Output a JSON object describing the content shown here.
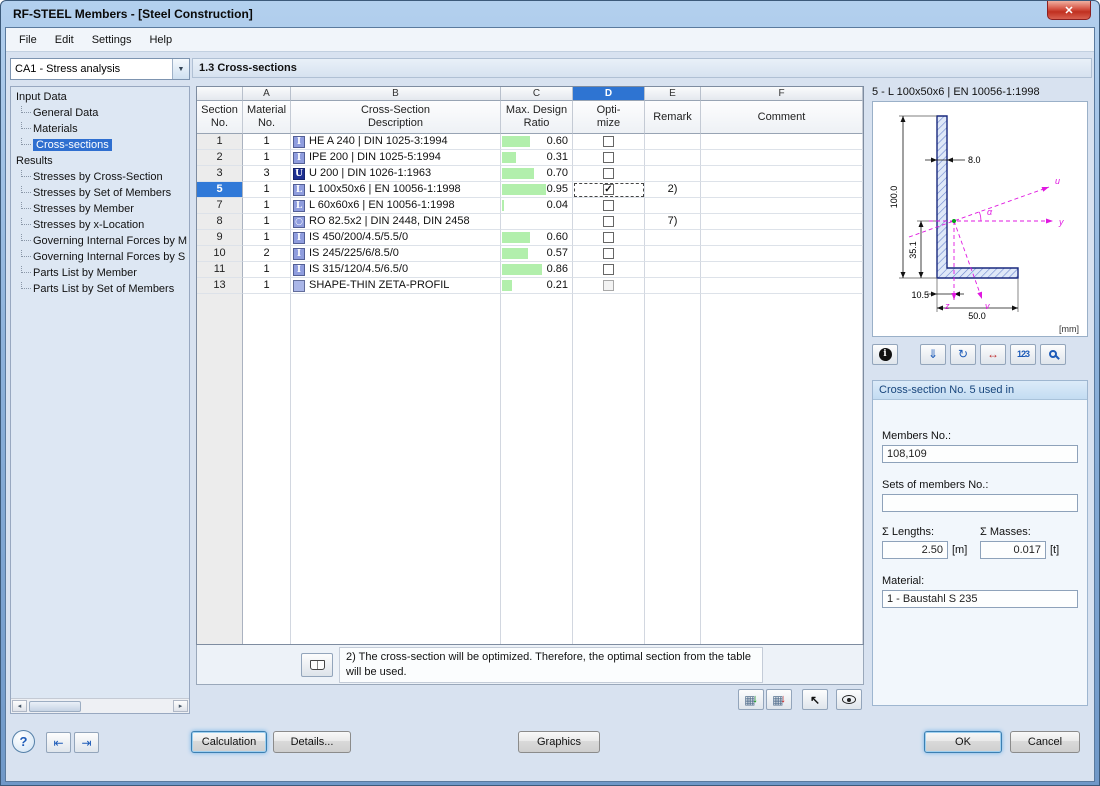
{
  "window": {
    "title": "RF-STEEL Members - [Steel Construction]"
  },
  "icons": {
    "close": "✕",
    "combo_arrow": "▼",
    "check": "✓",
    "scroll_left": "◂",
    "scroll_right": "▸",
    "info": "i",
    "save": "⇓",
    "rotate": "↻",
    "dims": "↔",
    "values": "123",
    "help": "?",
    "panel_left": "⇤",
    "panel_right": "⇥",
    "grid": "▦",
    "down_arrow": "↓",
    "pick": "↖"
  },
  "menu": {
    "items": [
      "File",
      "Edit",
      "Settings",
      "Help"
    ]
  },
  "case_selector": {
    "value": "CA1 - Stress analysis"
  },
  "nav": {
    "groups": [
      {
        "label": "Input Data",
        "items": [
          "General Data",
          "Materials",
          "Cross-sections"
        ]
      },
      {
        "label": "Results",
        "items": [
          "Stresses by Cross-Section",
          "Stresses by Set of Members",
          "Stresses by Member",
          "Stresses by x-Location",
          "Governing Internal Forces by M",
          "Governing Internal Forces by S",
          "Parts List by Member",
          "Parts List by Set of Members"
        ]
      }
    ],
    "selected": "Cross-sections"
  },
  "page": {
    "title": "1.3 Cross-sections"
  },
  "table": {
    "column_letters": [
      "",
      "A",
      "B",
      "C",
      "D",
      "E",
      "F"
    ],
    "current_letter": "D",
    "headers": [
      "Section\nNo.",
      "Material\nNo.",
      "Cross-Section\nDescription",
      "Max. Design\nRatio",
      "Opti-\nmize",
      "Remark",
      "Comment"
    ],
    "rows": [
      {
        "no": "1",
        "material": "1",
        "glyph": "I",
        "chip": "#8f9dde",
        "desc": "HE A 240 | DIN 1025-3:1994",
        "ratio": "0.60",
        "optimize": false,
        "remark": "",
        "comment": "",
        "selected": false,
        "disabled": false
      },
      {
        "no": "2",
        "material": "1",
        "glyph": "I",
        "chip": "#8f9dde",
        "desc": "IPE 200 | DIN 1025-5:1994",
        "ratio": "0.31",
        "optimize": false,
        "remark": "",
        "comment": "",
        "selected": false,
        "disabled": false
      },
      {
        "no": "3",
        "material": "3",
        "glyph": "U",
        "chip": "#1c2f92",
        "desc": "U 200 | DIN 1026-1:1963",
        "ratio": "0.70",
        "optimize": false,
        "remark": "",
        "comment": "",
        "selected": false,
        "disabled": false
      },
      {
        "no": "5",
        "material": "1",
        "glyph": "L",
        "chip": "#8f9dde",
        "desc": "L 100x50x6 | EN 10056-1:1998",
        "ratio": "0.95",
        "optimize": true,
        "remark": "2)",
        "comment": "",
        "selected": true,
        "disabled": false
      },
      {
        "no": "7",
        "material": "1",
        "glyph": "L",
        "chip": "#8f9dde",
        "desc": "L 60x60x6 | EN 10056-1:1998",
        "ratio": "0.04",
        "optimize": false,
        "remark": "",
        "comment": "",
        "selected": false,
        "disabled": false
      },
      {
        "no": "8",
        "material": "1",
        "glyph": "○",
        "chip": "#8f9dde",
        "desc": "RO 82.5x2 | DIN 2448, DIN 2458",
        "ratio": "",
        "optimize": false,
        "remark": "7)",
        "comment": "",
        "selected": false,
        "disabled": false
      },
      {
        "no": "9",
        "material": "1",
        "glyph": "I",
        "chip": "#8f9dde",
        "desc": "IS 450/200/4.5/5.5/0",
        "ratio": "0.60",
        "optimize": false,
        "remark": "",
        "comment": "",
        "selected": false,
        "disabled": false
      },
      {
        "no": "10",
        "material": "2",
        "glyph": "I",
        "chip": "#8f9dde",
        "desc": "IS 245/225/6/8.5/0",
        "ratio": "0.57",
        "optimize": false,
        "remark": "",
        "comment": "",
        "selected": false,
        "disabled": false
      },
      {
        "no": "11",
        "material": "1",
        "glyph": "I",
        "chip": "#8f9dde",
        "desc": "IS 315/120/4.5/6.5/0",
        "ratio": "0.86",
        "optimize": false,
        "remark": "",
        "comment": "",
        "selected": false,
        "disabled": false
      },
      {
        "no": "13",
        "material": "1",
        "glyph": "",
        "chip": "#aab6e8",
        "desc": "SHAPE-THIN ZETA-PROFIL",
        "ratio": "0.21",
        "optimize": false,
        "remark": "",
        "comment": "",
        "selected": false,
        "disabled": true
      }
    ],
    "footnote": "2) The cross-section will be optimized. Therefore, the optimal section from the table will be used."
  },
  "preview": {
    "title": "5 - L 100x50x6 | EN 10056-1:1998",
    "unit": "[mm]",
    "dims": {
      "height": "100.0",
      "width": "50.0",
      "thickness": "8.0",
      "ez": "35.1",
      "ey": "10.5"
    },
    "axes": {
      "u": "u",
      "v": "v",
      "y": "y",
      "z": "z",
      "alpha": "α"
    }
  },
  "details": {
    "header": "Cross-section No. 5 used in",
    "members_label": "Members No.:",
    "members_value": "108,109",
    "sets_label": "Sets of members No.:",
    "sets_value": "",
    "lengths_label": "Σ Lengths:",
    "lengths_value": "2.50",
    "lengths_unit": "[m]",
    "masses_label": "Σ Masses:",
    "masses_value": "0.017",
    "masses_unit": "[t]",
    "material_label": "Material:",
    "material_value": "1 - Baustahl S 235"
  },
  "footer": {
    "calculation": "Calculation",
    "details": "Details...",
    "graphics": "Graphics",
    "ok": "OK",
    "cancel": "Cancel"
  }
}
